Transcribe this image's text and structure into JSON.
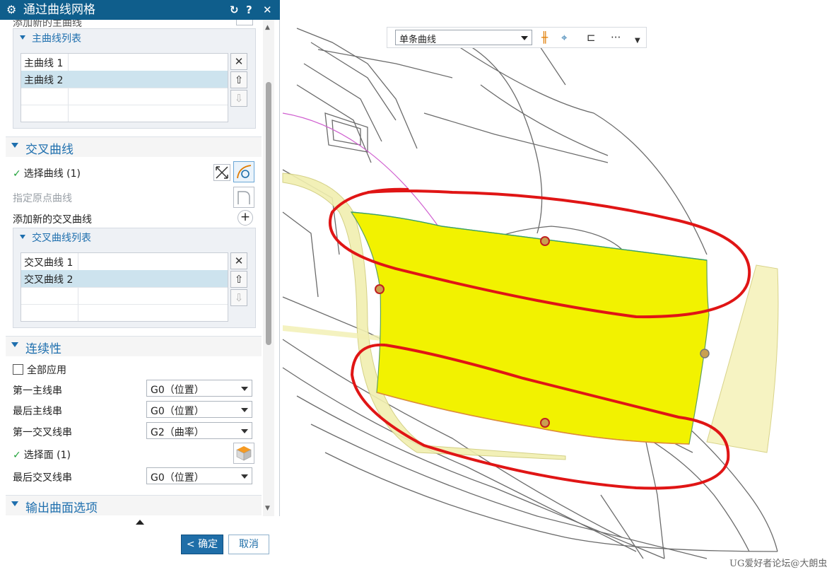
{
  "dialog": {
    "title": "通过曲线网格",
    "reset_icon": "reset-icon",
    "help_icon": "help-icon",
    "close_icon": "close-icon"
  },
  "primary": {
    "partial_label": "添加新的主曲线",
    "list_title": "主曲线列表",
    "rows": [
      "主曲线 1",
      "主曲线 2"
    ]
  },
  "cross": {
    "section_title": "交叉曲线",
    "select_label": "选择曲线 (1)",
    "origin_label": "指定原点曲线",
    "add_label": "添加新的交叉曲线",
    "list_title": "交叉曲线列表",
    "rows": [
      "交叉曲线 1",
      "交叉曲线 2"
    ]
  },
  "continuity": {
    "section_title": "连续性",
    "apply_all": "全部应用",
    "first_primary_label": "第一主线串",
    "first_primary_value": "G0（位置）",
    "last_primary_label": "最后主线串",
    "last_primary_value": "G0（位置）",
    "first_cross_label": "第一交叉线串",
    "first_cross_value": "G2（曲率）",
    "select_face_label": "选择面 (1)",
    "last_cross_label": "最后交叉线串",
    "last_cross_value": "G0（位置）"
  },
  "output": {
    "section_title": "输出曲面选项"
  },
  "buttons": {
    "ok": "< 确定 >",
    "cancel": "取消"
  },
  "toolbar": {
    "curve_rule": "单条曲线",
    "more": "···"
  },
  "watermark": "UG爱好者论坛@大朗虫",
  "colors": {
    "titlebar": "#0f5e8c",
    "accent": "#1e6fae",
    "surface": "#f2f200",
    "annotation": "#e01515"
  }
}
